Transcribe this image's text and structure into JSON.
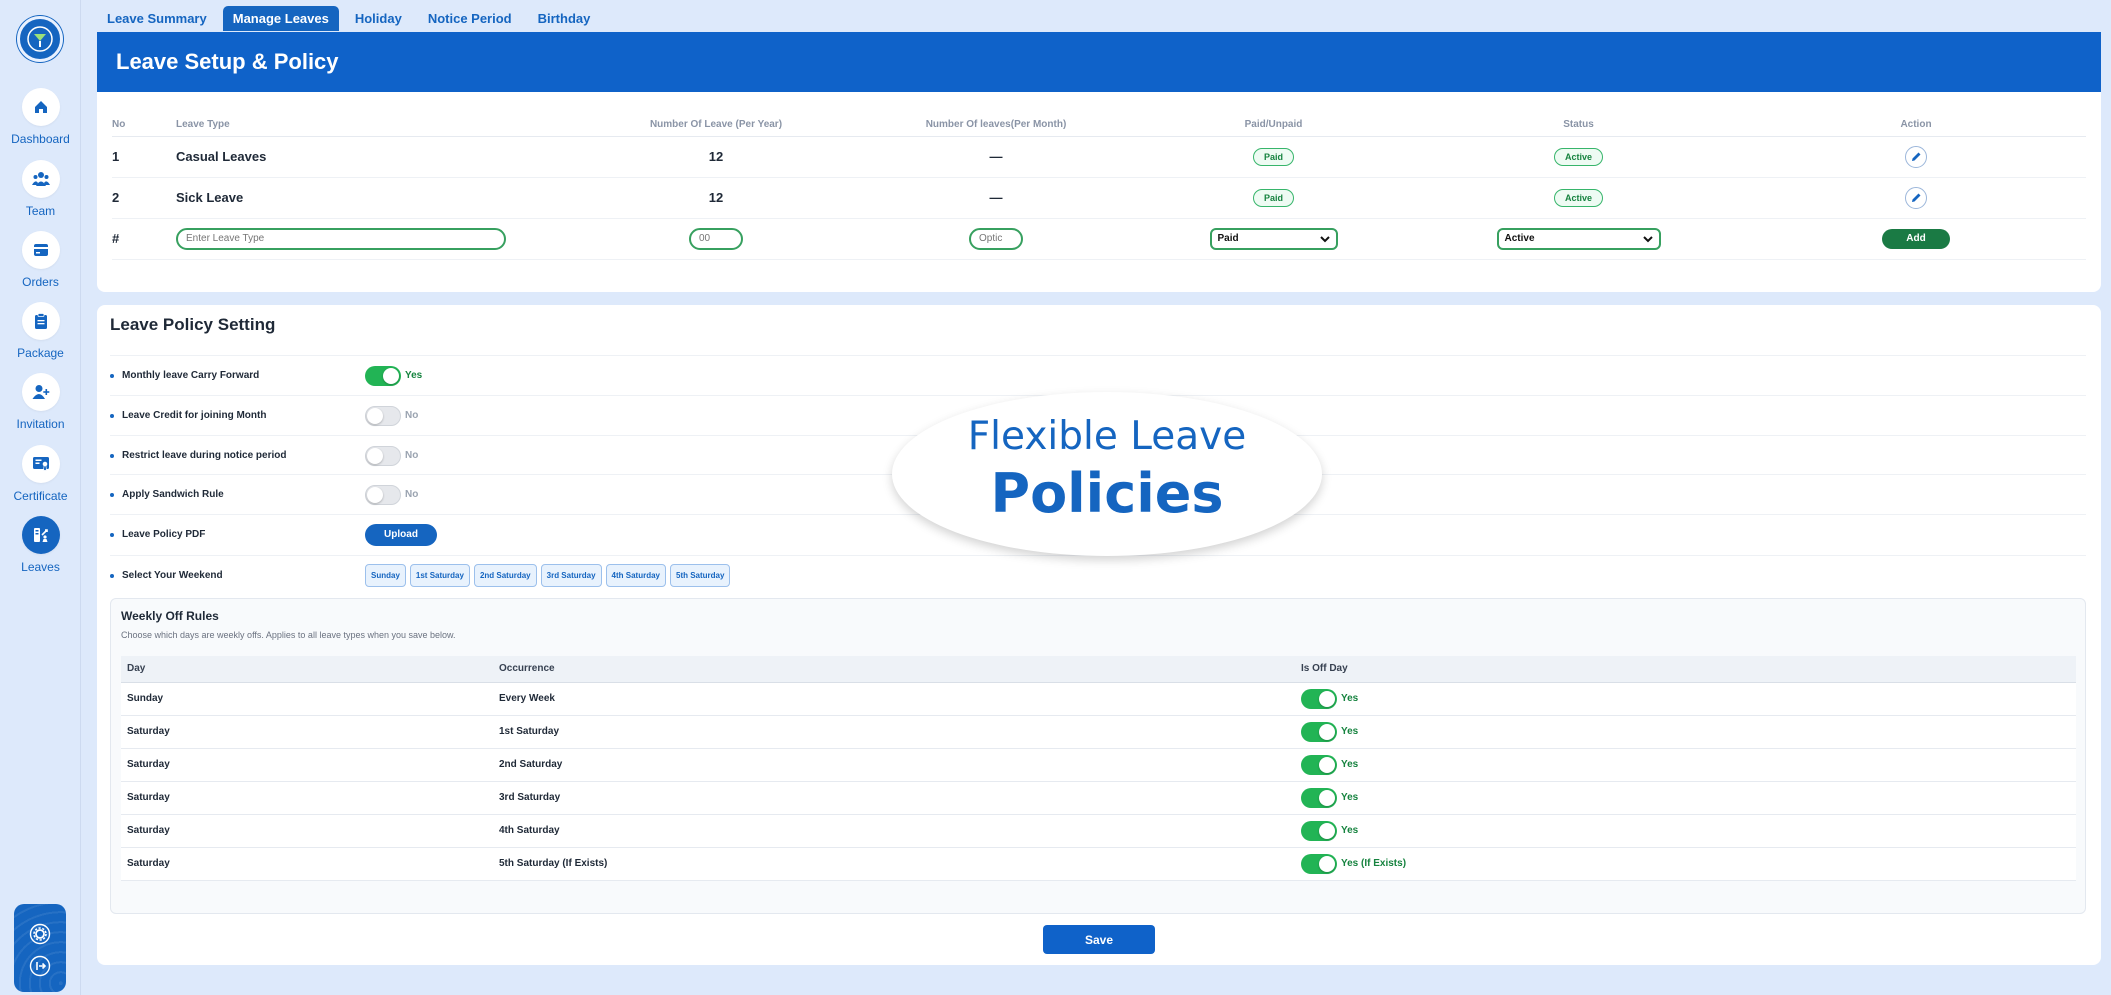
{
  "sidebar": {
    "items": [
      {
        "label": "Dashboard",
        "icon": "home-icon"
      },
      {
        "label": "Team",
        "icon": "team-icon"
      },
      {
        "label": "Orders",
        "icon": "orders-icon"
      },
      {
        "label": "Package",
        "icon": "package-icon"
      },
      {
        "label": "Invitation",
        "icon": "invitation-icon"
      },
      {
        "label": "Certificate",
        "icon": "certificate-icon"
      },
      {
        "label": "Leaves",
        "icon": "leaves-icon"
      }
    ]
  },
  "tabs": [
    "Leave Summary",
    "Manage Leaves",
    "Holiday",
    "Notice Period",
    "Birthday"
  ],
  "header": {
    "title": "Leave Setup & Policy"
  },
  "leave_table": {
    "headers": [
      "No",
      "Leave Type",
      "Number Of Leave (Per Year)",
      "Number Of leaves(Per Month)",
      "Paid/Unpaid",
      "Status",
      "Action"
    ],
    "rows": [
      {
        "no": "1",
        "type": "Casual Leaves",
        "per_year": "12",
        "per_month": "—",
        "paid": "Paid",
        "status": "Active"
      },
      {
        "no": "2",
        "type": "Sick Leave",
        "per_year": "12",
        "per_month": "—",
        "paid": "Paid",
        "status": "Active"
      }
    ],
    "new_row": {
      "no": "#",
      "type_placeholder": "Enter Leave Type",
      "year_placeholder": "00",
      "month_placeholder": "Optic",
      "paid_value": "Paid",
      "status_value": "Active",
      "add_label": "Add"
    }
  },
  "policy": {
    "title": "Leave Policy Setting",
    "settings": [
      {
        "label": "Monthly leave Carry Forward",
        "state": "Yes"
      },
      {
        "label": "Leave Credit for joining Month",
        "state": "No"
      },
      {
        "label": "Restrict leave during notice period",
        "state": "No"
      },
      {
        "label": "Apply Sandwich Rule",
        "state": "No"
      }
    ],
    "pdf_label": "Leave Policy PDF",
    "upload_label": "Upload",
    "weekend_label": "Select Your Weekend",
    "weekend_options": [
      "Sunday",
      "1st Saturday",
      "2nd Saturday",
      "3rd Saturday",
      "4th Saturday",
      "5th Saturday"
    ]
  },
  "weekly_off": {
    "title": "Weekly Off Rules",
    "subtitle": "Choose which days are weekly offs. Applies to all leave types when you save below.",
    "headers": [
      "Day",
      "Occurrence",
      "Is Off Day"
    ],
    "rows": [
      {
        "day": "Sunday",
        "occurrence": "Every Week",
        "off": "Yes"
      },
      {
        "day": "Saturday",
        "occurrence": "1st Saturday",
        "off": "Yes"
      },
      {
        "day": "Saturday",
        "occurrence": "2nd Saturday",
        "off": "Yes"
      },
      {
        "day": "Saturday",
        "occurrence": "3rd Saturday",
        "off": "Yes"
      },
      {
        "day": "Saturday",
        "occurrence": "4th Saturday",
        "off": "Yes"
      },
      {
        "day": "Saturday",
        "occurrence": "5th Saturday (If Exists)",
        "off": "Yes (If Exists)"
      }
    ]
  },
  "save_label": "Save",
  "overlay": {
    "line1": "Flexible Leave",
    "line2": "Policies"
  },
  "colors": {
    "primary": "#1565c0",
    "header": "#0f62c9",
    "success": "#22b455",
    "add": "#1a7a44"
  }
}
